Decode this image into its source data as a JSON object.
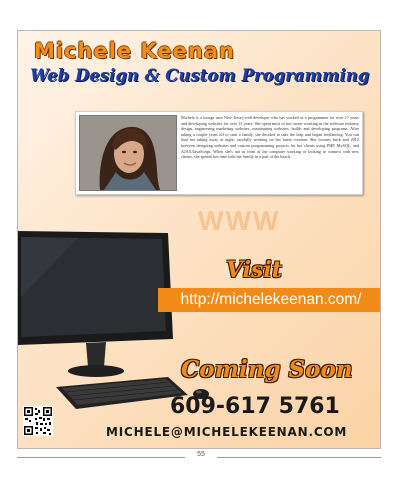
{
  "ad": {
    "name": "Michele Keenan",
    "tagline": "Web Design & Custom Programming",
    "bio": "Michele is a lounge area New Jersey web developer who has worked as a programmer for over 17 years and developing websites for over 13 years. She spent most of her career working in the software industry design, engineering marketing websites, maintaining websites, builds and developing programs. After taking a couple years off to start a family, she decided to take the leap and began freelancing. You can find her taking away at night, carefully working on her latest creation. She focuses back and 2012 between designing websites and custom programming projects for her clients using PHP, MySQL, and AJAX/JavaScript. When she's not in front of the computer working or looking to connect with new clients, she spends her time with her family in a part of the beach.",
    "watermark": "WWW",
    "visit": "Visit",
    "url": "http://michelekeenan.com/",
    "coming_soon": "Coming Soon",
    "phone": "609-617 5761",
    "email": "MICHELE@MICHELEKEENAN.COM"
  },
  "page_number": "55",
  "colors": {
    "orange": "#f28a17",
    "blue": "#1e3fa0",
    "background": "#fde3c6"
  }
}
